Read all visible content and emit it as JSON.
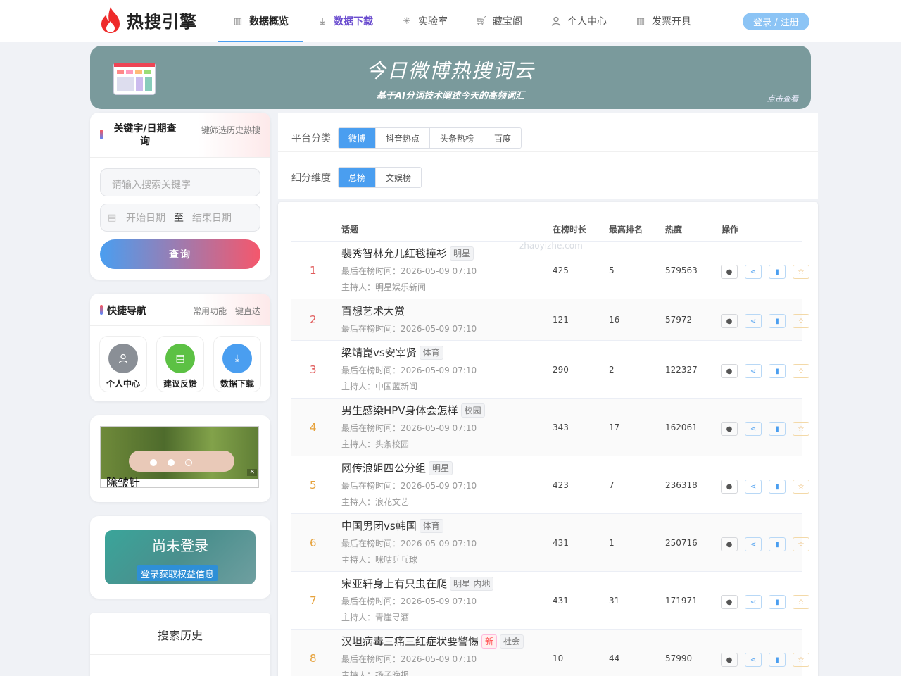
{
  "header": {
    "logo_text": "热搜引擎",
    "nav": [
      {
        "label": "数据概览",
        "icon": "table-icon"
      },
      {
        "label": "数据下载",
        "icon": "download-icon"
      },
      {
        "label": "实验室",
        "icon": "spinner-icon"
      },
      {
        "label": "藏宝阁",
        "icon": "cart-icon"
      },
      {
        "label": "个人中心",
        "icon": "user-icon"
      },
      {
        "label": "发票开具",
        "icon": "table-icon"
      }
    ],
    "login_label": "登录 / 注册"
  },
  "banner": {
    "title": "今日微博热搜词云",
    "subtitle": "基于AI分词技术阐述今天的高频词汇",
    "more": "点击查看"
  },
  "search_card": {
    "title": "关键字/日期查询",
    "subtitle": "一键筛选历史热搜",
    "keyword_placeholder": "请输入搜索关键字",
    "start_placeholder": "开始日期",
    "to_label": "至",
    "end_placeholder": "结束日期",
    "query_label": "查询"
  },
  "quick_nav": {
    "title": "快捷导航",
    "subtitle": "常用功能一键直达",
    "items": [
      {
        "label": "个人中心",
        "icon": "user-icon",
        "color": "#8a8f96"
      },
      {
        "label": "建议反馈",
        "icon": "feedback-icon",
        "color": "#5cc144"
      },
      {
        "label": "数据下载",
        "icon": "download-icon",
        "color": "#4a9ef0"
      }
    ]
  },
  "ad": {
    "caption": "除皱针"
  },
  "login_card": {
    "title": "尚未登录",
    "button": "登录获取权益信息"
  },
  "history_card": {
    "title": "搜索历史"
  },
  "filters": {
    "platform_label": "平台分类",
    "platforms": [
      "微博",
      "抖音热点",
      "头条热榜",
      "百度"
    ],
    "dimension_label": "细分维度",
    "dimensions": [
      "总榜",
      "文娱榜"
    ]
  },
  "table": {
    "headers": {
      "topic": "话题",
      "duration": "在榜时长",
      "max_rank": "最高排名",
      "heat": "热度",
      "ops": "操作"
    },
    "watermark": "zhaoyizhe.com",
    "rows": [
      {
        "rank": "1",
        "topic": "裴秀智林允儿红毯撞衫",
        "tags": [
          "明星"
        ],
        "last": "最后在榜时间：2026-05-09 07:10",
        "host": "主持人：明星娱乐新闻",
        "duration": "425",
        "max_rank": "5",
        "heat": "579563"
      },
      {
        "rank": "2",
        "topic": "百想艺术大赏",
        "tags": [],
        "last": "最后在榜时间：2026-05-09 07:10",
        "host": "",
        "duration": "121",
        "max_rank": "16",
        "heat": "57972"
      },
      {
        "rank": "3",
        "topic": "梁靖崑vs安宰贤",
        "tags": [
          "体育"
        ],
        "last": "最后在榜时间：2026-05-09 07:10",
        "host": "主持人：中国蓝新闻",
        "duration": "290",
        "max_rank": "2",
        "heat": "122327"
      },
      {
        "rank": "4",
        "topic": "男生感染HPV身体会怎样",
        "tags": [
          "校园"
        ],
        "last": "最后在榜时间：2026-05-09 07:10",
        "host": "主持人：头条校园",
        "duration": "343",
        "max_rank": "17",
        "heat": "162061"
      },
      {
        "rank": "5",
        "topic": "网传浪姐四公分组",
        "tags": [
          "明星"
        ],
        "last": "最后在榜时间：2026-05-09 07:10",
        "host": "主持人：浪花文艺",
        "duration": "423",
        "max_rank": "7",
        "heat": "236318"
      },
      {
        "rank": "6",
        "topic": "中国男团vs韩国",
        "tags": [
          "体育"
        ],
        "last": "最后在榜时间：2026-05-09 07:10",
        "host": "主持人：咪咕乒乓球",
        "duration": "431",
        "max_rank": "1",
        "heat": "250716"
      },
      {
        "rank": "7",
        "topic": "宋亚轩身上有只虫在爬",
        "tags": [
          "明星-内地"
        ],
        "last": "最后在榜时间：2026-05-09 07:10",
        "host": "主持人：青崖寻酒",
        "duration": "431",
        "max_rank": "31",
        "heat": "171971"
      },
      {
        "rank": "8",
        "topic": "汉坦病毒三痛三红症状要警惕",
        "tags": [
          "新",
          "社会"
        ],
        "last": "最后在榜时间：2026-05-09 07:10",
        "host": "主持人：扬子晚报",
        "duration": "10",
        "max_rank": "44",
        "heat": "57990"
      }
    ]
  },
  "colors": {
    "accent": "#4a9ef0",
    "rank_top": "#e05a5a",
    "rank_other": "#e6a23c",
    "banner_bg": "#7a9a9c"
  }
}
